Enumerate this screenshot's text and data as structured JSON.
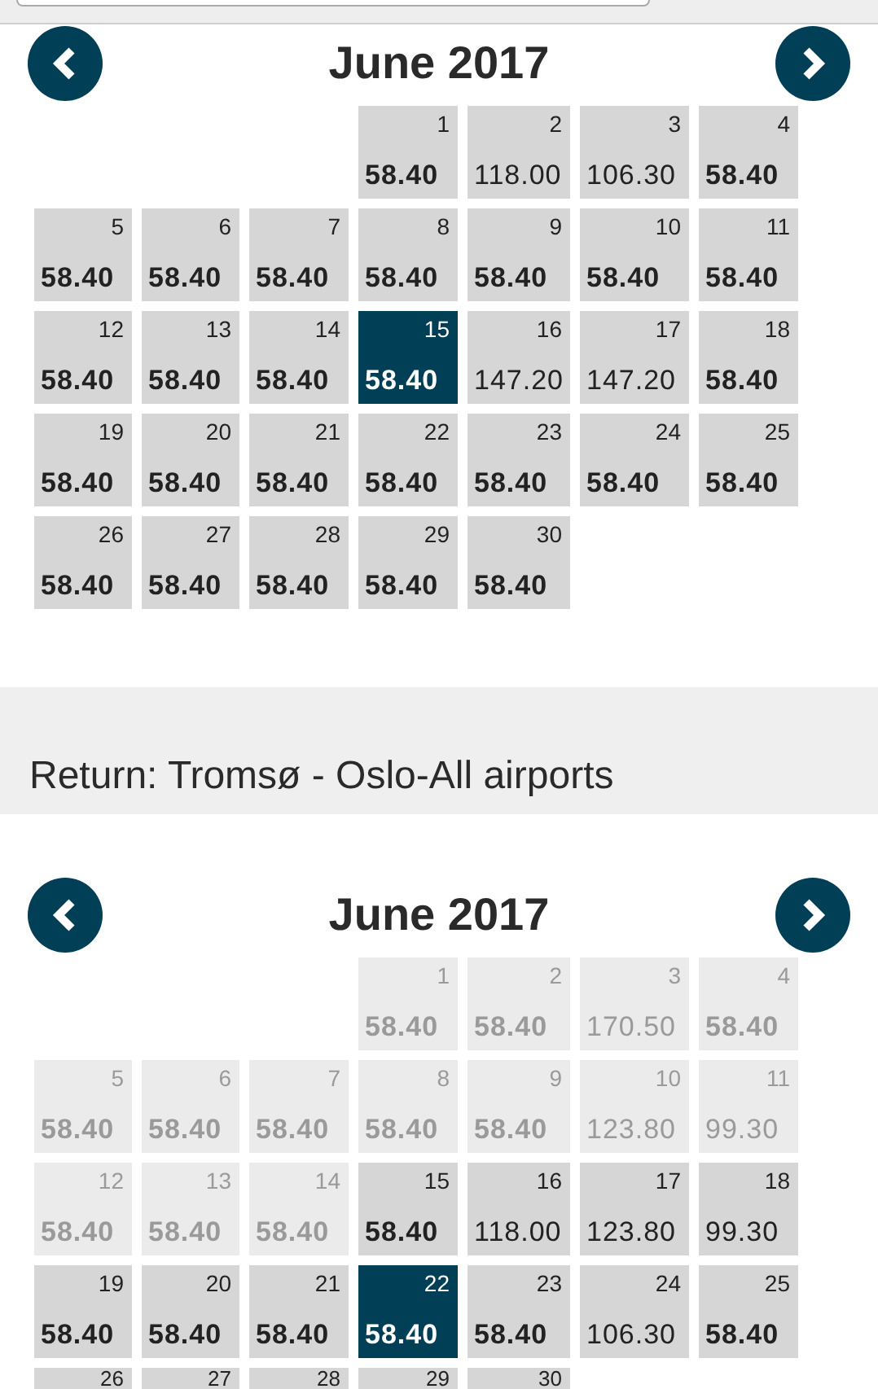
{
  "outbound": {
    "month": "June 2017",
    "weeks": [
      [
        {
          "day": "1",
          "price": "58.40",
          "cheap": true,
          "disabled": false,
          "selected": false
        },
        {
          "day": "2",
          "price": "118.00",
          "cheap": false,
          "disabled": false,
          "selected": false
        },
        {
          "day": "3",
          "price": "106.30",
          "cheap": false,
          "disabled": false,
          "selected": false
        },
        {
          "day": "4",
          "price": "58.40",
          "cheap": true,
          "disabled": false,
          "selected": false
        }
      ],
      [
        {
          "day": "5",
          "price": "58.40",
          "cheap": true,
          "disabled": false,
          "selected": false
        },
        {
          "day": "6",
          "price": "58.40",
          "cheap": true,
          "disabled": false,
          "selected": false
        },
        {
          "day": "7",
          "price": "58.40",
          "cheap": true,
          "disabled": false,
          "selected": false
        },
        {
          "day": "8",
          "price": "58.40",
          "cheap": true,
          "disabled": false,
          "selected": false
        },
        {
          "day": "9",
          "price": "58.40",
          "cheap": true,
          "disabled": false,
          "selected": false
        },
        {
          "day": "10",
          "price": "58.40",
          "cheap": true,
          "disabled": false,
          "selected": false
        },
        {
          "day": "11",
          "price": "58.40",
          "cheap": true,
          "disabled": false,
          "selected": false
        }
      ],
      [
        {
          "day": "12",
          "price": "58.40",
          "cheap": true,
          "disabled": false,
          "selected": false
        },
        {
          "day": "13",
          "price": "58.40",
          "cheap": true,
          "disabled": false,
          "selected": false
        },
        {
          "day": "14",
          "price": "58.40",
          "cheap": true,
          "disabled": false,
          "selected": false
        },
        {
          "day": "15",
          "price": "58.40",
          "cheap": true,
          "disabled": false,
          "selected": true
        },
        {
          "day": "16",
          "price": "147.20",
          "cheap": false,
          "disabled": false,
          "selected": false
        },
        {
          "day": "17",
          "price": "147.20",
          "cheap": false,
          "disabled": false,
          "selected": false
        },
        {
          "day": "18",
          "price": "58.40",
          "cheap": true,
          "disabled": false,
          "selected": false
        }
      ],
      [
        {
          "day": "19",
          "price": "58.40",
          "cheap": true,
          "disabled": false,
          "selected": false
        },
        {
          "day": "20",
          "price": "58.40",
          "cheap": true,
          "disabled": false,
          "selected": false
        },
        {
          "day": "21",
          "price": "58.40",
          "cheap": true,
          "disabled": false,
          "selected": false
        },
        {
          "day": "22",
          "price": "58.40",
          "cheap": true,
          "disabled": false,
          "selected": false
        },
        {
          "day": "23",
          "price": "58.40",
          "cheap": true,
          "disabled": false,
          "selected": false
        },
        {
          "day": "24",
          "price": "58.40",
          "cheap": true,
          "disabled": false,
          "selected": false
        },
        {
          "day": "25",
          "price": "58.40",
          "cheap": true,
          "disabled": false,
          "selected": false
        }
      ],
      [
        {
          "day": "26",
          "price": "58.40",
          "cheap": true,
          "disabled": false,
          "selected": false
        },
        {
          "day": "27",
          "price": "58.40",
          "cheap": true,
          "disabled": false,
          "selected": false
        },
        {
          "day": "28",
          "price": "58.40",
          "cheap": true,
          "disabled": false,
          "selected": false
        },
        {
          "day": "29",
          "price": "58.40",
          "cheap": true,
          "disabled": false,
          "selected": false
        },
        {
          "day": "30",
          "price": "58.40",
          "cheap": true,
          "disabled": false,
          "selected": false
        }
      ]
    ]
  },
  "return_heading": "Return: Tromsø - Oslo-All airports",
  "return": {
    "month": "June 2017",
    "weeks": [
      [
        {
          "day": "1",
          "price": "58.40",
          "cheap": true,
          "disabled": true,
          "selected": false
        },
        {
          "day": "2",
          "price": "58.40",
          "cheap": true,
          "disabled": true,
          "selected": false
        },
        {
          "day": "3",
          "price": "170.50",
          "cheap": false,
          "disabled": true,
          "selected": false
        },
        {
          "day": "4",
          "price": "58.40",
          "cheap": true,
          "disabled": true,
          "selected": false
        }
      ],
      [
        {
          "day": "5",
          "price": "58.40",
          "cheap": true,
          "disabled": true,
          "selected": false
        },
        {
          "day": "6",
          "price": "58.40",
          "cheap": true,
          "disabled": true,
          "selected": false
        },
        {
          "day": "7",
          "price": "58.40",
          "cheap": true,
          "disabled": true,
          "selected": false
        },
        {
          "day": "8",
          "price": "58.40",
          "cheap": true,
          "disabled": true,
          "selected": false
        },
        {
          "day": "9",
          "price": "58.40",
          "cheap": true,
          "disabled": true,
          "selected": false
        },
        {
          "day": "10",
          "price": "123.80",
          "cheap": false,
          "disabled": true,
          "selected": false
        },
        {
          "day": "11",
          "price": "99.30",
          "cheap": false,
          "disabled": true,
          "selected": false
        }
      ],
      [
        {
          "day": "12",
          "price": "58.40",
          "cheap": true,
          "disabled": true,
          "selected": false
        },
        {
          "day": "13",
          "price": "58.40",
          "cheap": true,
          "disabled": true,
          "selected": false
        },
        {
          "day": "14",
          "price": "58.40",
          "cheap": true,
          "disabled": true,
          "selected": false
        },
        {
          "day": "15",
          "price": "58.40",
          "cheap": true,
          "disabled": false,
          "selected": false
        },
        {
          "day": "16",
          "price": "118.00",
          "cheap": false,
          "disabled": false,
          "selected": false
        },
        {
          "day": "17",
          "price": "123.80",
          "cheap": false,
          "disabled": false,
          "selected": false
        },
        {
          "day": "18",
          "price": "99.30",
          "cheap": false,
          "disabled": false,
          "selected": false
        }
      ],
      [
        {
          "day": "19",
          "price": "58.40",
          "cheap": true,
          "disabled": false,
          "selected": false
        },
        {
          "day": "20",
          "price": "58.40",
          "cheap": true,
          "disabled": false,
          "selected": false
        },
        {
          "day": "21",
          "price": "58.40",
          "cheap": true,
          "disabled": false,
          "selected": false
        },
        {
          "day": "22",
          "price": "58.40",
          "cheap": true,
          "disabled": false,
          "selected": true
        },
        {
          "day": "23",
          "price": "58.40",
          "cheap": true,
          "disabled": false,
          "selected": false
        },
        {
          "day": "24",
          "price": "106.30",
          "cheap": false,
          "disabled": false,
          "selected": false
        },
        {
          "day": "25",
          "price": "58.40",
          "cheap": true,
          "disabled": false,
          "selected": false
        }
      ],
      [
        {
          "day": "26",
          "disabled": false,
          "selected": false
        },
        {
          "day": "27",
          "disabled": false,
          "selected": false
        },
        {
          "day": "28",
          "disabled": false,
          "selected": false
        },
        {
          "day": "29",
          "disabled": false,
          "selected": false
        },
        {
          "day": "30",
          "disabled": false,
          "selected": false
        }
      ]
    ]
  }
}
